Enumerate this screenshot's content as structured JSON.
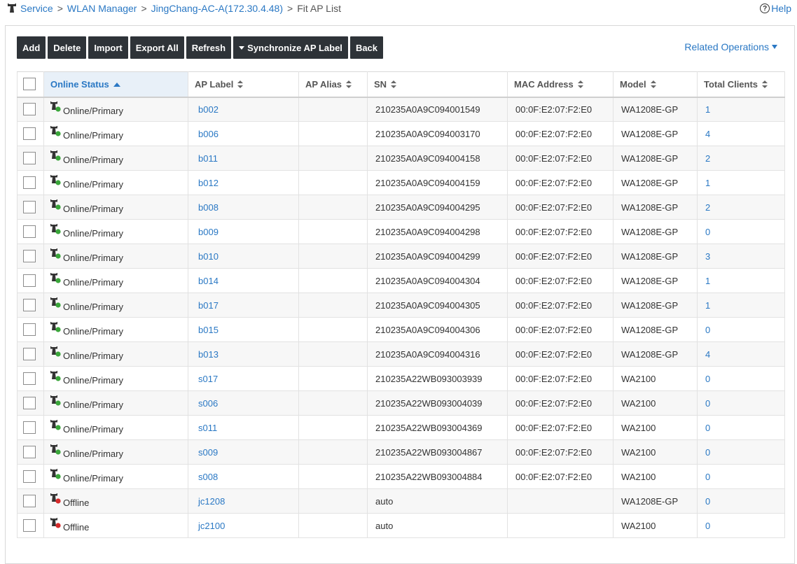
{
  "breadcrumb": {
    "items": [
      "Service",
      "WLAN Manager",
      "JingChang-AC-A(172.30.4.48)"
    ],
    "separator": ">",
    "current": "Fit AP List"
  },
  "help": {
    "icon": "?",
    "label": "Help"
  },
  "toolbar": {
    "add": "Add",
    "delete": "Delete",
    "import": "Import",
    "export_all": "Export All",
    "refresh": "Refresh",
    "sync_label": "Synchronize AP Label",
    "back": "Back"
  },
  "related_operations": "Related Operations",
  "table": {
    "columns": [
      "Online Status",
      "AP Label",
      "AP Alias",
      "SN",
      "MAC Address",
      "Model",
      "Total Clients"
    ],
    "sorted_column": "Online Status",
    "rows": [
      {
        "status": "Online/Primary",
        "online": true,
        "label": "b002",
        "alias": "",
        "sn": "210235A0A9C094001549",
        "mac": "00:0F:E2:07:F2:E0",
        "model": "WA1208E-GP",
        "clients": "1"
      },
      {
        "status": "Online/Primary",
        "online": true,
        "label": "b006",
        "alias": "",
        "sn": "210235A0A9C094003170",
        "mac": "00:0F:E2:07:F2:E0",
        "model": "WA1208E-GP",
        "clients": "4"
      },
      {
        "status": "Online/Primary",
        "online": true,
        "label": "b011",
        "alias": "",
        "sn": "210235A0A9C094004158",
        "mac": "00:0F:E2:07:F2:E0",
        "model": "WA1208E-GP",
        "clients": "2"
      },
      {
        "status": "Online/Primary",
        "online": true,
        "label": "b012",
        "alias": "",
        "sn": "210235A0A9C094004159",
        "mac": "00:0F:E2:07:F2:E0",
        "model": "WA1208E-GP",
        "clients": "1"
      },
      {
        "status": "Online/Primary",
        "online": true,
        "label": "b008",
        "alias": "",
        "sn": "210235A0A9C094004295",
        "mac": "00:0F:E2:07:F2:E0",
        "model": "WA1208E-GP",
        "clients": "2"
      },
      {
        "status": "Online/Primary",
        "online": true,
        "label": "b009",
        "alias": "",
        "sn": "210235A0A9C094004298",
        "mac": "00:0F:E2:07:F2:E0",
        "model": "WA1208E-GP",
        "clients": "0"
      },
      {
        "status": "Online/Primary",
        "online": true,
        "label": "b010",
        "alias": "",
        "sn": "210235A0A9C094004299",
        "mac": "00:0F:E2:07:F2:E0",
        "model": "WA1208E-GP",
        "clients": "3"
      },
      {
        "status": "Online/Primary",
        "online": true,
        "label": "b014",
        "alias": "",
        "sn": "210235A0A9C094004304",
        "mac": "00:0F:E2:07:F2:E0",
        "model": "WA1208E-GP",
        "clients": "1"
      },
      {
        "status": "Online/Primary",
        "online": true,
        "label": "b017",
        "alias": "",
        "sn": "210235A0A9C094004305",
        "mac": "00:0F:E2:07:F2:E0",
        "model": "WA1208E-GP",
        "clients": "1"
      },
      {
        "status": "Online/Primary",
        "online": true,
        "label": "b015",
        "alias": "",
        "sn": "210235A0A9C094004306",
        "mac": "00:0F:E2:07:F2:E0",
        "model": "WA1208E-GP",
        "clients": "0"
      },
      {
        "status": "Online/Primary",
        "online": true,
        "label": "b013",
        "alias": "",
        "sn": "210235A0A9C094004316",
        "mac": "00:0F:E2:07:F2:E0",
        "model": "WA1208E-GP",
        "clients": "4"
      },
      {
        "status": "Online/Primary",
        "online": true,
        "label": "s017",
        "alias": "",
        "sn": "210235A22WB093003939",
        "mac": "00:0F:E2:07:F2:E0",
        "model": "WA2100",
        "clients": "0"
      },
      {
        "status": "Online/Primary",
        "online": true,
        "label": "s006",
        "alias": "",
        "sn": "210235A22WB093004039",
        "mac": "00:0F:E2:07:F2:E0",
        "model": "WA2100",
        "clients": "0"
      },
      {
        "status": "Online/Primary",
        "online": true,
        "label": "s011",
        "alias": "",
        "sn": "210235A22WB093004369",
        "mac": "00:0F:E2:07:F2:E0",
        "model": "WA2100",
        "clients": "0"
      },
      {
        "status": "Online/Primary",
        "online": true,
        "label": "s009",
        "alias": "",
        "sn": "210235A22WB093004867",
        "mac": "00:0F:E2:07:F2:E0",
        "model": "WA2100",
        "clients": "0"
      },
      {
        "status": "Online/Primary",
        "online": true,
        "label": "s008",
        "alias": "",
        "sn": "210235A22WB093004884",
        "mac": "00:0F:E2:07:F2:E0",
        "model": "WA2100",
        "clients": "0"
      },
      {
        "status": "Offline",
        "online": false,
        "label": "jc1208",
        "alias": "",
        "sn": "auto",
        "mac": "",
        "model": "WA1208E-GP",
        "clients": "0"
      },
      {
        "status": "Offline",
        "online": false,
        "label": "jc2100",
        "alias": "",
        "sn": "auto",
        "mac": "",
        "model": "WA2100",
        "clients": "0"
      }
    ]
  },
  "colors": {
    "accent": "#2a78c4",
    "button_bg": "#2e3338",
    "online_dot": "#3aa63a",
    "offline_dot": "#d62b2b"
  },
  "icons": {
    "home": "ap-tower-icon",
    "status_online": "ap-online-icon",
    "status_offline": "ap-offline-icon"
  }
}
